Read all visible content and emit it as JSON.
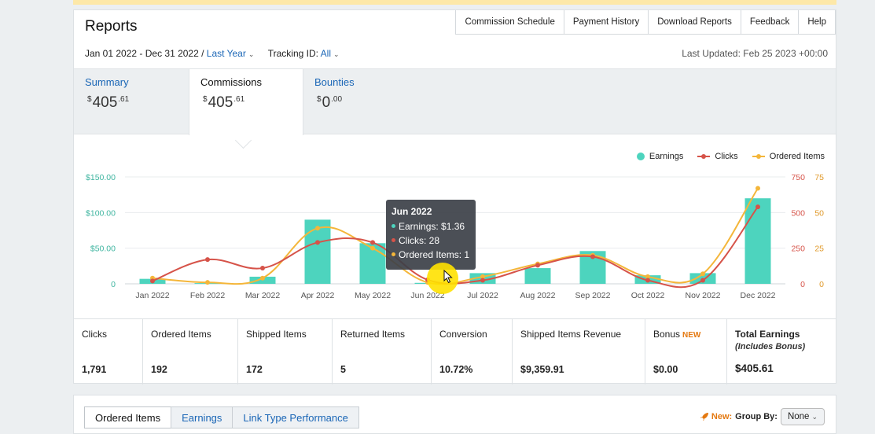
{
  "reports": {
    "title": "Reports",
    "top_tabs": [
      "Commission Schedule",
      "Payment History",
      "Download Reports",
      "Feedback",
      "Help"
    ],
    "date_range": "Jan 01 2022 - Dec 31 2022 /",
    "date_preset": "Last Year",
    "tracking_label": "Tracking ID:",
    "tracking_value": "All",
    "last_updated": "Last Updated: Feb 25 2023 +00:00"
  },
  "summary_tabs": [
    {
      "label": "Summary",
      "currency": "$",
      "whole": "405",
      "cents": ".61"
    },
    {
      "label": "Commissions",
      "currency": "$",
      "whole": "405",
      "cents": ".61"
    },
    {
      "label": "Bounties",
      "currency": "$",
      "whole": "0",
      "cents": ".00"
    }
  ],
  "legend": [
    "Earnings",
    "Clicks",
    "Ordered Items"
  ],
  "colors": {
    "earnings": "#4dd4be",
    "clicks": "#d65349",
    "ordered": "#f4b63a",
    "link": "#1a66b6"
  },
  "chart_data": {
    "type": "bar",
    "categories": [
      "Jan 2022",
      "Feb 2022",
      "Mar 2022",
      "Apr 2022",
      "May 2022",
      "Jun 2022",
      "Jul 2022",
      "Aug 2022",
      "Sep 2022",
      "Oct 2022",
      "Nov 2022",
      "Dec 2022"
    ],
    "y_left_ticks": [
      "$150.00",
      "$100.00",
      "$50.00",
      "0"
    ],
    "y_right1_ticks": [
      "750",
      "500",
      "250",
      "0"
    ],
    "y_right2_ticks": [
      "75",
      "50",
      "25",
      "0"
    ],
    "series": [
      {
        "name": "Earnings",
        "type": "bar",
        "axis": "left",
        "ylim": [
          0,
          150
        ],
        "values": [
          7,
          1,
          10,
          90,
          57,
          1.36,
          15,
          22,
          46,
          12,
          15,
          120
        ]
      },
      {
        "name": "Clicks",
        "type": "line",
        "axis": "right1",
        "ylim": [
          0,
          750
        ],
        "values": [
          20,
          170,
          110,
          290,
          290,
          28,
          25,
          130,
          190,
          25,
          25,
          540
        ]
      },
      {
        "name": "Ordered Items",
        "type": "line",
        "axis": "right2",
        "ylim": [
          0,
          75
        ],
        "values": [
          4,
          1,
          4,
          39,
          25,
          1,
          5,
          14,
          20,
          5,
          7,
          67
        ]
      }
    ]
  },
  "tooltip": {
    "title": "Jun 2022",
    "earnings": "Earnings: $1.36",
    "clicks": "Clicks: 28",
    "ordered": "Ordered Items: 1"
  },
  "stats": [
    {
      "label": "Clicks",
      "value": "1,791"
    },
    {
      "label": "Ordered Items",
      "value": "192"
    },
    {
      "label": "Shipped Items",
      "value": "172"
    },
    {
      "label": "Returned Items",
      "value": "5"
    },
    {
      "label": "Conversion",
      "value": "10.72%"
    },
    {
      "label": "Shipped Items Revenue",
      "value": "$9,359.91"
    },
    {
      "label": "Bonus",
      "badge": "NEW",
      "value": "$0.00"
    },
    {
      "label": "Total Earnings",
      "sub": "(Includes Bonus)",
      "value": "$405.61"
    }
  ],
  "bottom": {
    "tabs": [
      "Ordered Items",
      "Earnings",
      "Link Type Performance"
    ],
    "new_label": "New:",
    "group_by_label": "Group By:",
    "group_by_value": "None"
  }
}
